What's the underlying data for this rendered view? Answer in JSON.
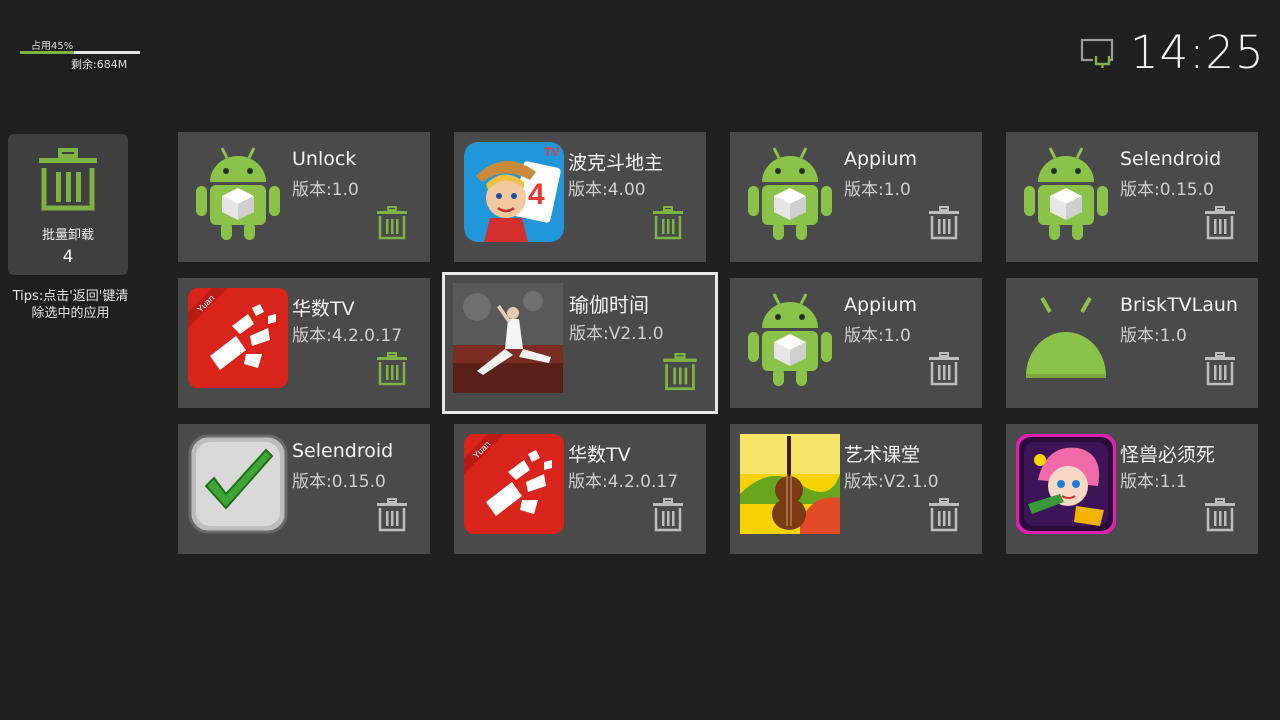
{
  "storage": {
    "used_label": "占用45%",
    "used_percent": 45,
    "free_label": "剩余:684M"
  },
  "status": {
    "network_icon": "network-display-icon",
    "time": "14:25"
  },
  "batch": {
    "label": "批量卸载",
    "count": "4",
    "icon": "trash-icon"
  },
  "tips": "Tips:点击'返回'键清除选中的应用",
  "colors": {
    "accent_green": "#7cb342",
    "card_bg": "#4a4a4a",
    "page_bg": "#1f1f1f"
  },
  "apps": [
    {
      "name": "Unlock",
      "version": "版本:1.0",
      "icon": "android-box-icon"
    },
    {
      "name": "波克斗地主",
      "version": "版本:4.00",
      "icon": "poker-game-icon"
    },
    {
      "name": "Appium",
      "version": "版本:1.0",
      "icon": "android-box-icon"
    },
    {
      "name": "Selendroid",
      "version": "版本:0.15.0",
      "icon": "android-box-icon"
    },
    {
      "name": "华数TV",
      "version": "版本:4.2.0.17",
      "icon": "huashu-tv-icon",
      "badge": "Yuan"
    },
    {
      "name": "瑜伽时间",
      "version": "版本:V2.1.0",
      "icon": "yoga-photo-icon",
      "selected": true
    },
    {
      "name": "Appium",
      "version": "版本:1.0",
      "icon": "android-box-icon"
    },
    {
      "name": "BriskTVLaun",
      "version": "版本:1.0",
      "icon": "android-head-icon"
    },
    {
      "name": "Selendroid",
      "version": "版本:0.15.0",
      "icon": "checkmark-icon"
    },
    {
      "name": "华数TV",
      "version": "版本:4.2.0.17",
      "icon": "huashu-tv-icon",
      "badge": "Yuan"
    },
    {
      "name": "艺术课堂",
      "version": "版本:V2.1.0",
      "icon": "violin-icon"
    },
    {
      "name": "怪兽必须死",
      "version": "版本:1.1",
      "icon": "monster-game-icon"
    }
  ]
}
